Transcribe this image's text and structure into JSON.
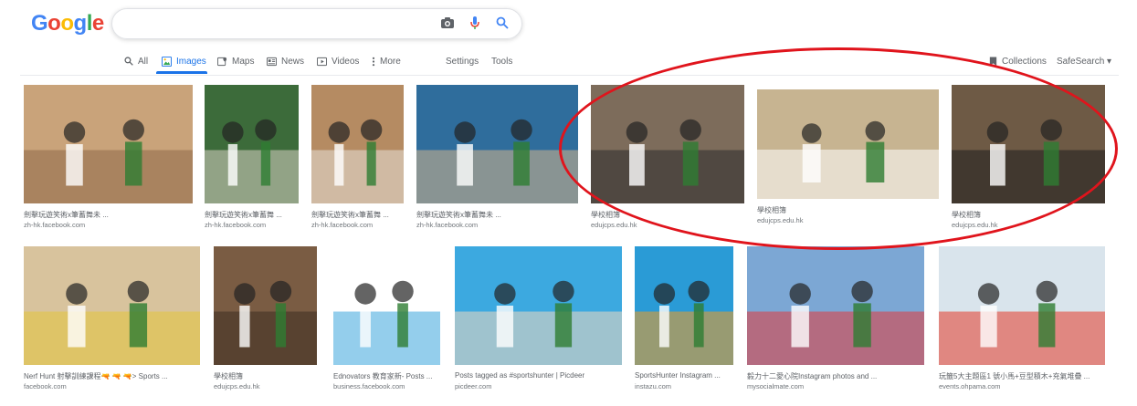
{
  "logo": {
    "letters": [
      {
        "ch": "G",
        "color": "#4285f4"
      },
      {
        "ch": "o",
        "color": "#ea4335"
      },
      {
        "ch": "o",
        "color": "#fbbc05"
      },
      {
        "ch": "g",
        "color": "#4285f4"
      },
      {
        "ch": "l",
        "color": "#34a853"
      },
      {
        "ch": "e",
        "color": "#ea4335"
      }
    ]
  },
  "search": {
    "value": "",
    "icons": [
      "camera-icon",
      "microphone-icon",
      "search-icon"
    ]
  },
  "tabs": [
    {
      "label": "All",
      "icon": "search-icon"
    },
    {
      "label": "Images",
      "icon": "image-icon",
      "active": true
    },
    {
      "label": "Maps",
      "icon": "map-icon"
    },
    {
      "label": "News",
      "icon": "news-icon"
    },
    {
      "label": "Videos",
      "icon": "video-icon"
    },
    {
      "label": "More",
      "icon": "more-icon"
    }
  ],
  "tools": {
    "settings": "Settings",
    "tools": "Tools"
  },
  "right_nav": {
    "collections": "Collections",
    "safesearch": "SafeSearch ▾"
  },
  "results": [
    {
      "caption": "劍擊玩遊笑術x筆蓄舞未 ...",
      "source": "zh-hk.facebook.com"
    },
    {
      "caption": "劍擊玩遊笑術x筆蓄舞 ...",
      "source": "zh-hk.facebook.com"
    },
    {
      "caption": "劍擊玩遊笑術x筆蓄舞 ...",
      "source": "zh-hk.facebook.com"
    },
    {
      "caption": "劍擊玩遊笑術x筆蓄舞未 ...",
      "source": "zh-hk.facebook.com"
    },
    {
      "caption": "學校相簿",
      "source": "edujcps.edu.hk"
    },
    {
      "caption": "學校相簿",
      "source": "edujcps.edu.hk"
    },
    {
      "caption": "學校相簿",
      "source": "edujcps.edu.hk"
    },
    {
      "caption": "Nerf Hunt 射擊訓練課程🔫 🔫 🔫> Sports ...",
      "source": "facebook.com"
    },
    {
      "caption": "學校相簿",
      "source": "edujcps.edu.hk"
    },
    {
      "caption": "Ednovators 教育家新- Posts ...",
      "source": "business.facebook.com"
    },
    {
      "caption": "Posts tagged as #sportshunter | Picdeer",
      "source": "picdeer.com"
    },
    {
      "caption": "SportsHunter Instagram ...",
      "source": "instazu.com"
    },
    {
      "caption": "毅力十二愛心院Instagram photos and ...",
      "source": "mysocialmate.com"
    },
    {
      "caption": "玩籤5大主題區1 號小馬+豆型積木+充氣堆疊 ...",
      "source": "events.ohpama.com"
    }
  ],
  "colors": {
    "accent": "#1a73e8",
    "annotation": "#e0141c"
  }
}
